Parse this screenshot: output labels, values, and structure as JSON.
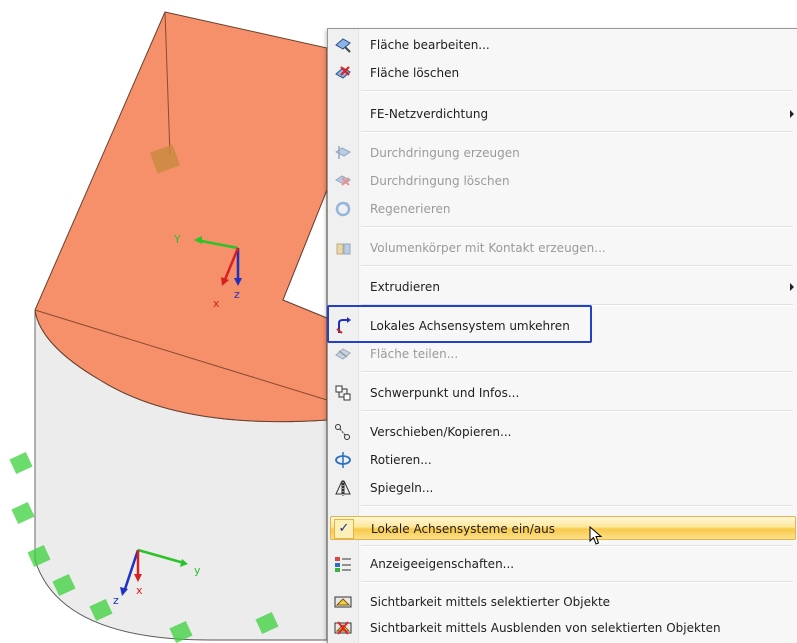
{
  "viewport": {
    "axes_top": {
      "y": "Y",
      "x": "x",
      "z": "z"
    },
    "axes_bottom": {
      "y": "y",
      "x": "x",
      "z": "z"
    },
    "colors": {
      "surface": "#f5906a",
      "solid_side": "#ececec",
      "support": "#3bd13b"
    }
  },
  "menu": {
    "items": [
      {
        "label": "Fläche bearbeiten...",
        "icon": "edit-surface-icon",
        "disabled": false
      },
      {
        "label": "Fläche löschen",
        "icon": "delete-surface-icon",
        "disabled": false
      },
      {
        "label": "FE-Netzverdichtung",
        "icon": "",
        "disabled": false,
        "submenu": true
      },
      {
        "label": "Durchdringung erzeugen",
        "icon": "create-intersection-icon",
        "disabled": true
      },
      {
        "label": "Durchdringung löschen",
        "icon": "delete-intersection-icon",
        "disabled": true
      },
      {
        "label": "Regenerieren",
        "icon": "regenerate-icon",
        "disabled": true
      },
      {
        "label": "Volumenkörper mit Kontakt erzeugen...",
        "icon": "contact-solid-icon",
        "disabled": true
      },
      {
        "label": "Extrudieren",
        "icon": "",
        "disabled": false,
        "submenu": true
      },
      {
        "label": "Lokales Achsensystem umkehren",
        "icon": "reverse-axis-icon",
        "disabled": false
      },
      {
        "label": "Fläche teilen...",
        "icon": "divide-surface-icon",
        "disabled": true
      },
      {
        "label": "Schwerpunkt und Infos...",
        "icon": "centroid-info-icon",
        "disabled": false
      },
      {
        "label": "Verschieben/Kopieren...",
        "icon": "move-copy-icon",
        "disabled": false
      },
      {
        "label": "Rotieren...",
        "icon": "rotate-icon",
        "disabled": false
      },
      {
        "label": "Spiegeln...",
        "icon": "mirror-icon",
        "disabled": false
      },
      {
        "label": "Lokale Achsensysteme ein/aus",
        "icon": "checkmark-icon",
        "disabled": false,
        "checked": true
      },
      {
        "label": "Anzeigeeigenschaften...",
        "icon": "display-properties-icon",
        "disabled": false
      },
      {
        "label": "Sichtbarkeit mittels selektierter Objekte",
        "icon": "visibility-selected-icon",
        "disabled": false
      },
      {
        "label": "Sichtbarkeit mittels Ausblenden von selektierten Objekten",
        "icon": "visibility-hide-selected-icon",
        "disabled": false
      }
    ],
    "check_glyph": "✓",
    "colors": {
      "highlight_border": "#2340c8",
      "active_top": "#fff8d8",
      "active_bottom": "#f9c94a"
    }
  }
}
